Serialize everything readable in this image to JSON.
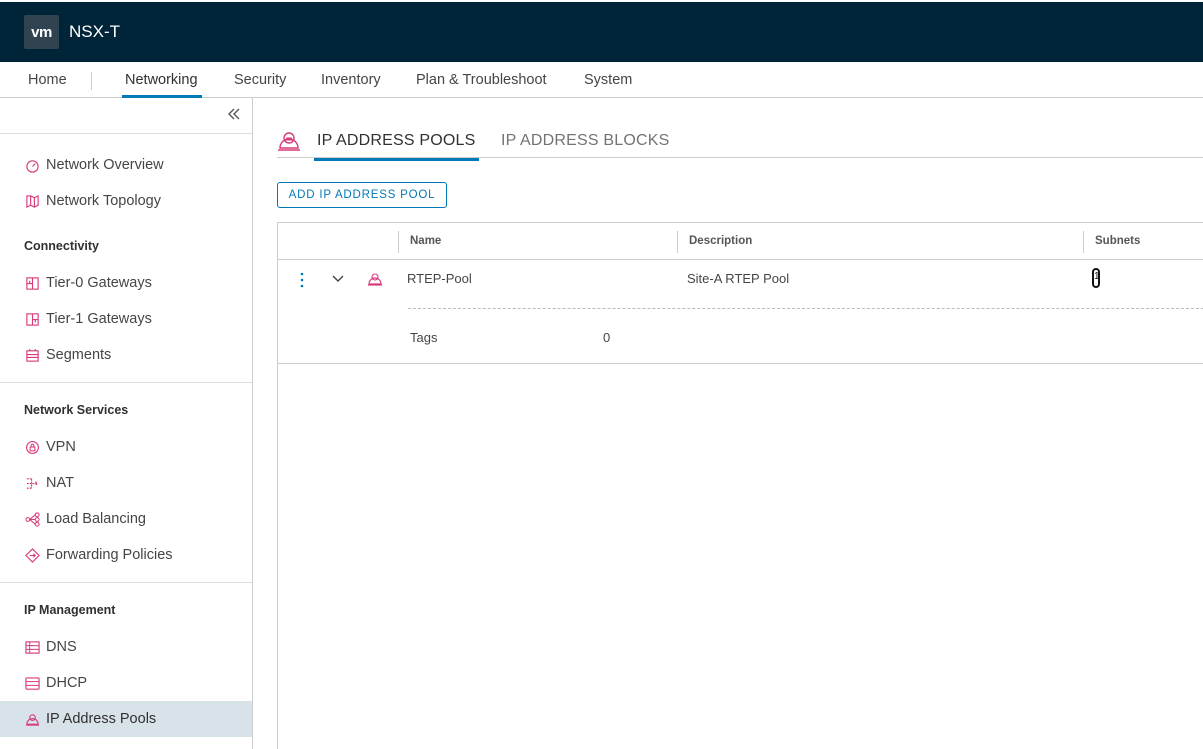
{
  "header": {
    "logo_text": "vm",
    "app_title": "NSX-T",
    "bg_color": "#002538"
  },
  "nav": {
    "items": [
      {
        "label": "Home"
      },
      {
        "label": "Networking"
      },
      {
        "label": "Security"
      },
      {
        "label": "Inventory"
      },
      {
        "label": "Plan & Troubleshoot"
      },
      {
        "label": "System"
      }
    ],
    "active": "Networking",
    "accent_color": "#0079b8"
  },
  "sidebar": {
    "collapse_icon": "double-chevron-left-icon",
    "top_items": [
      {
        "label": "Network Overview",
        "icon": "gauge-icon"
      },
      {
        "label": "Network Topology",
        "icon": "topology-icon"
      }
    ],
    "sections": [
      {
        "header": "Connectivity",
        "items": [
          {
            "label": "Tier-0 Gateways",
            "icon": "gateway-icon"
          },
          {
            "label": "Tier-1 Gateways",
            "icon": "gateway-icon"
          },
          {
            "label": "Segments",
            "icon": "segment-icon"
          }
        ]
      },
      {
        "header": "Network Services",
        "items": [
          {
            "label": "VPN",
            "icon": "vpn-icon"
          },
          {
            "label": "NAT",
            "icon": "nat-icon"
          },
          {
            "label": "Load Balancing",
            "icon": "load-balancer-icon"
          },
          {
            "label": "Forwarding Policies",
            "icon": "forwarding-icon"
          }
        ]
      },
      {
        "header": "IP Management",
        "items": [
          {
            "label": "DNS",
            "icon": "dns-icon"
          },
          {
            "label": "DHCP",
            "icon": "dhcp-icon"
          },
          {
            "label": "IP Address Pools",
            "icon": "ip-pool-icon",
            "selected": true
          }
        ]
      }
    ],
    "icon_color": "#d73a7a"
  },
  "main": {
    "tabs": [
      {
        "label": "IP ADDRESS POOLS",
        "active": true
      },
      {
        "label": "IP ADDRESS BLOCKS",
        "active": false
      }
    ],
    "add_button": "ADD IP ADDRESS POOL",
    "table": {
      "columns": [
        "Name",
        "Description",
        "Subnets"
      ],
      "rows": [
        {
          "name": "RTEP-Pool",
          "description": "Site-A RTEP Pool",
          "subnets": "1",
          "expanded": {
            "tags_label": "Tags",
            "tags_value": "0"
          }
        }
      ]
    }
  }
}
